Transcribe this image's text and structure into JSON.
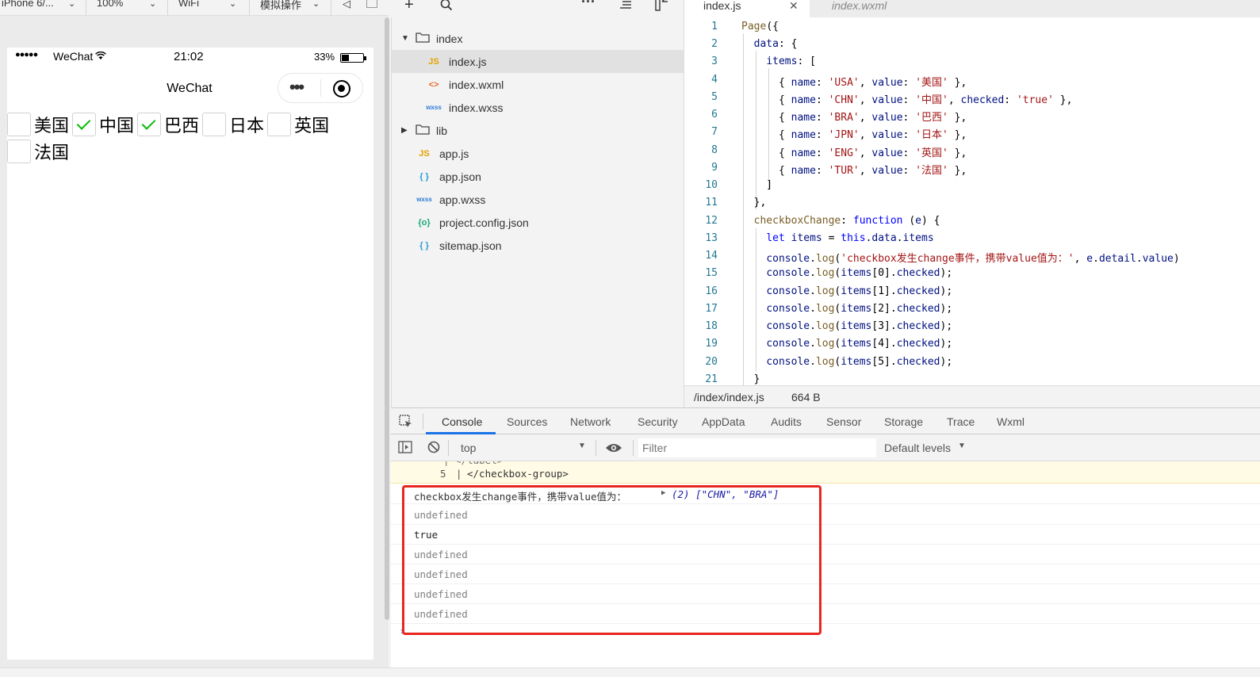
{
  "simulator": {
    "toolbar": {
      "device": "iPhone 6/...",
      "zoom": "100%",
      "network": "WiFi",
      "operation": "模拟操作"
    },
    "statusbar": {
      "signal": "●●●●●",
      "carrier": "WeChat",
      "time": "21:02",
      "battery": "33%",
      "battery_level": 0.33
    },
    "navbar": {
      "title": "WeChat"
    },
    "checkboxes": [
      {
        "label": "美国",
        "checked": false
      },
      {
        "label": "中国",
        "checked": true
      },
      {
        "label": "巴西",
        "checked": true
      },
      {
        "label": "日本",
        "checked": false
      },
      {
        "label": "英国",
        "checked": false
      },
      {
        "label": "法国",
        "checked": false
      }
    ]
  },
  "file_tree": {
    "items": [
      {
        "name": "index",
        "type": "folder",
        "icon": "folder-open-icon"
      },
      {
        "name": "index.js",
        "type": "js",
        "icon": "js-file-icon",
        "icon_text": "JS"
      },
      {
        "name": "index.wxml",
        "type": "wxml",
        "icon": "wxml-file-icon",
        "icon_text": "<>"
      },
      {
        "name": "index.wxss",
        "type": "wxss",
        "icon": "wxss-file-icon",
        "icon_text": "wxss"
      },
      {
        "name": "lib",
        "type": "folder",
        "icon": "folder-closed-icon"
      },
      {
        "name": "app.js",
        "type": "js",
        "icon": "js-file-icon",
        "icon_text": "JS"
      },
      {
        "name": "app.json",
        "type": "json",
        "icon": "json-file-icon",
        "icon_text": "{ }"
      },
      {
        "name": "app.wxss",
        "type": "wxss",
        "icon": "wxss-file-icon",
        "icon_text": "wxss"
      },
      {
        "name": "project.config.json",
        "type": "config",
        "icon": "config-file-icon",
        "icon_text": "{o}"
      },
      {
        "name": "sitemap.json",
        "type": "json",
        "icon": "json-file-icon",
        "icon_text": "{ }"
      }
    ]
  },
  "editor": {
    "tabs": [
      {
        "label": "index.js",
        "active": true
      },
      {
        "label": "index.wxml",
        "active": false
      }
    ],
    "status": {
      "path": "/index/index.js",
      "size": "664 B"
    },
    "line_numbers": [
      "1",
      "2",
      "3",
      "4",
      "5",
      "6",
      "7",
      "8",
      "9",
      "10",
      "11",
      "12",
      "13",
      "14",
      "15",
      "16",
      "17",
      "18",
      "19",
      "20",
      "21"
    ]
  },
  "devtools": {
    "tabs": [
      "Console",
      "Sources",
      "Network",
      "Security",
      "AppData",
      "Audits",
      "Sensor",
      "Storage",
      "Trace",
      "Wxml"
    ],
    "active_tab": "Console",
    "context": "top",
    "filter_placeholder": "Filter",
    "levels": "Default levels",
    "console": {
      "prev_line_no": "5",
      "prev_code": "</checkbox-group>",
      "log_message": "checkbox发生change事件，携带value值为：",
      "log_array": "(2) [\"CHN\", \"BRA\"]",
      "entries": [
        "undefined",
        "true",
        "undefined",
        "undefined",
        "undefined",
        "undefined"
      ]
    }
  },
  "colors": {
    "checkmark": "#09bb07",
    "highlight_box": "#e8261f",
    "active_tab_underline": "#1a73e8"
  }
}
